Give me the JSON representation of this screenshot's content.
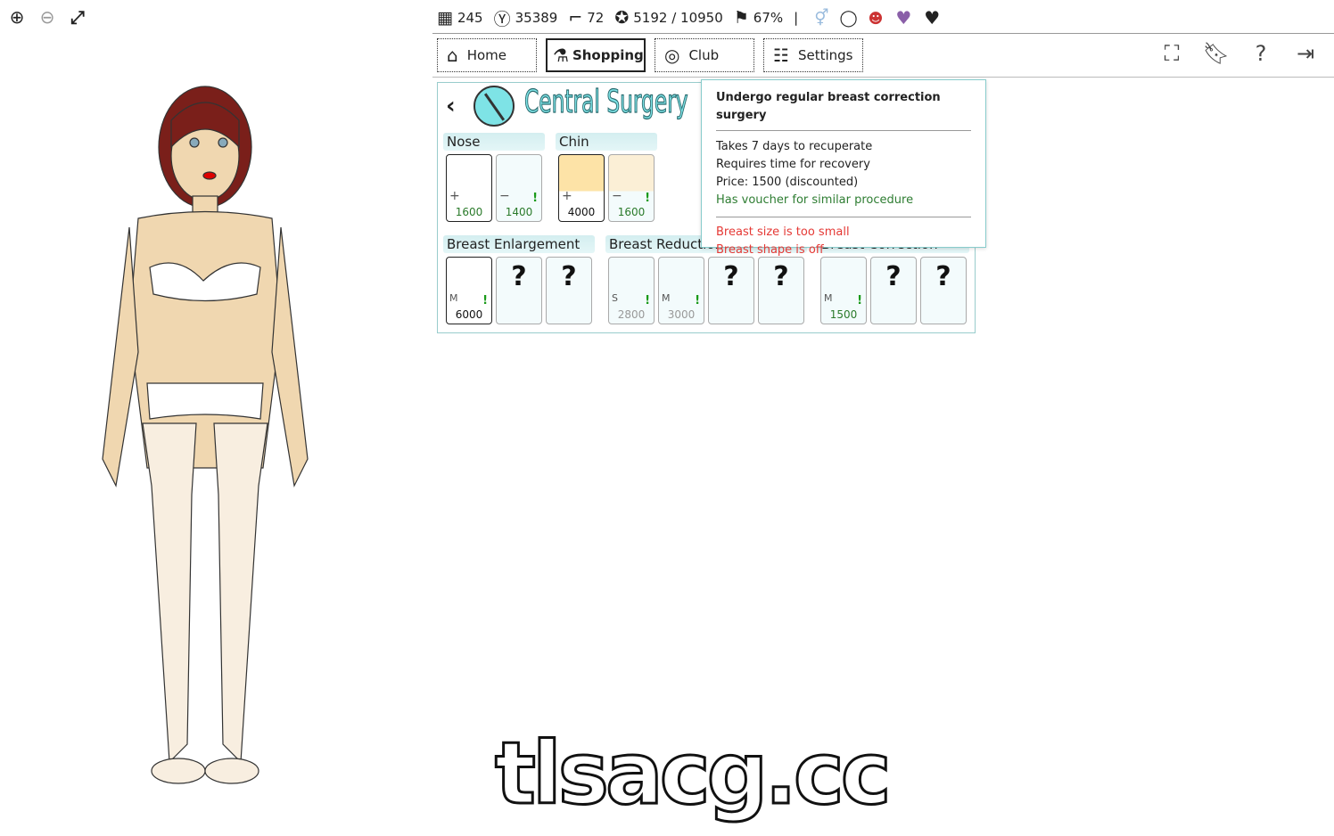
{
  "zoom_controls": {
    "icons": [
      "zoom-in-icon",
      "zoom-out-icon",
      "fullscreen-icon"
    ]
  },
  "stats": {
    "days": "245",
    "money": "35389",
    "level": "72",
    "reputation": "5192 / 10950",
    "progress": "67%",
    "separator": "|"
  },
  "nav": {
    "home": "Home",
    "shopping": "Shopping",
    "club": "Club",
    "settings": "Settings"
  },
  "shop": {
    "title": "Central Surgery",
    "sections": [
      {
        "label": "Nose",
        "items": [
          {
            "sign": "+",
            "price": "1600",
            "price_color": "#2a7a2a",
            "active": true
          },
          {
            "sign": "−",
            "price": "1400",
            "price_color": "#2a7a2a",
            "alert": "!"
          }
        ]
      },
      {
        "label": "Chin",
        "items": [
          {
            "sign": "+",
            "price": "4000",
            "active": true
          },
          {
            "sign": "−",
            "price": "1600",
            "price_color": "#2a7a2a",
            "alert": "!"
          }
        ]
      },
      {
        "label": "Breast Enlargement",
        "items": [
          {
            "size": "M",
            "price": "6000",
            "active": true,
            "alert": "!"
          },
          {
            "unknown": "?"
          },
          {
            "unknown": "?"
          }
        ]
      },
      {
        "label": "Breast Reduction",
        "items": [
          {
            "size": "S",
            "price": "2800",
            "alert": "!"
          },
          {
            "size": "M",
            "price": "3000",
            "alert": "!"
          },
          {
            "unknown": "?"
          },
          {
            "unknown": "?"
          }
        ]
      },
      {
        "label": "Breast Correction",
        "items": [
          {
            "size": "M",
            "price": "1500",
            "price_color": "#2a7a2a",
            "alert": "!"
          },
          {
            "unknown": "?"
          },
          {
            "unknown": "?"
          }
        ]
      }
    ]
  },
  "tooltip": {
    "title": "Undergo regular breast correction surgery",
    "lines": [
      "Takes 7 days to recuperate",
      "Requires time for recovery",
      "Price: 1500 (discounted)"
    ],
    "voucher": "Has voucher for similar procedure",
    "warnings": [
      "Breast size is too small",
      "Breast shape is off"
    ]
  },
  "watermark": "tlsacg.cc"
}
